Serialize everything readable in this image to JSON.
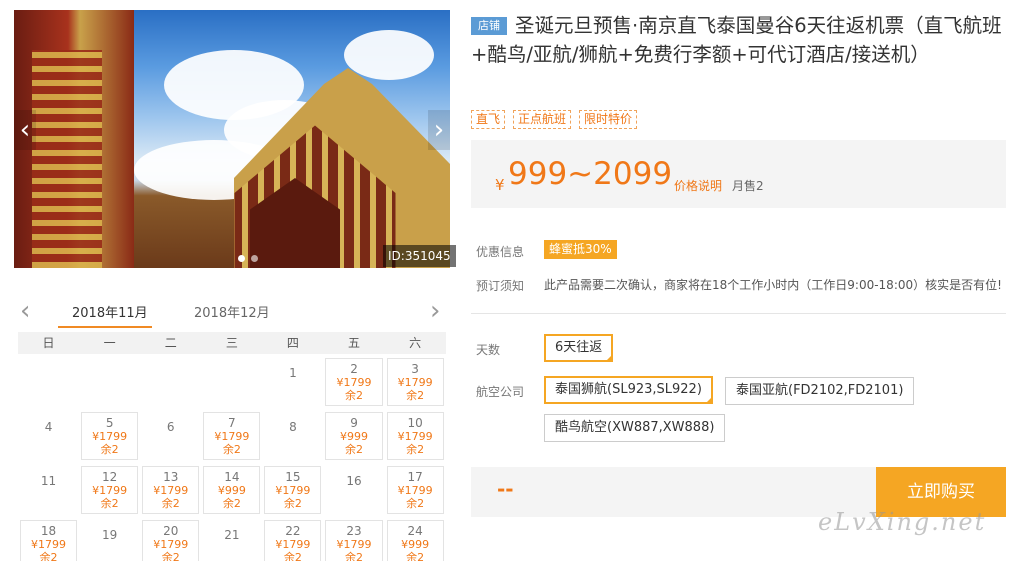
{
  "photo": {
    "id_label": "ID:351045",
    "prev_icon": "‹",
    "next_icon": "›"
  },
  "calendar": {
    "prev_icon": "‹",
    "next_icon": "›",
    "tabs": [
      {
        "label": "2018年11月",
        "active": true
      },
      {
        "label": "2018年12月",
        "active": false
      }
    ],
    "weekdays": [
      "日",
      "一",
      "二",
      "三",
      "四",
      "五",
      "六"
    ],
    "weeks": [
      [
        {
          "day": "",
          "price": "",
          "stock": ""
        },
        {
          "day": "",
          "price": "",
          "stock": ""
        },
        {
          "day": "",
          "price": "",
          "stock": ""
        },
        {
          "day": "",
          "price": "",
          "stock": ""
        },
        {
          "day": "1",
          "price": "",
          "stock": ""
        },
        {
          "day": "2",
          "price": "¥1799",
          "stock": "余2"
        },
        {
          "day": "3",
          "price": "¥1799",
          "stock": "余2"
        }
      ],
      [
        {
          "day": "4",
          "price": "",
          "stock": ""
        },
        {
          "day": "5",
          "price": "¥1799",
          "stock": "余2"
        },
        {
          "day": "6",
          "price": "",
          "stock": ""
        },
        {
          "day": "7",
          "price": "¥1799",
          "stock": "余2"
        },
        {
          "day": "8",
          "price": "",
          "stock": ""
        },
        {
          "day": "9",
          "price": "¥999",
          "stock": "余2"
        },
        {
          "day": "10",
          "price": "¥1799",
          "stock": "余2"
        }
      ],
      [
        {
          "day": "11",
          "price": "",
          "stock": ""
        },
        {
          "day": "12",
          "price": "¥1799",
          "stock": "余2"
        },
        {
          "day": "13",
          "price": "¥1799",
          "stock": "余2"
        },
        {
          "day": "14",
          "price": "¥999",
          "stock": "余2"
        },
        {
          "day": "15",
          "price": "¥1799",
          "stock": "余2"
        },
        {
          "day": "16",
          "price": "",
          "stock": ""
        },
        {
          "day": "17",
          "price": "¥1799",
          "stock": "余2"
        }
      ],
      [
        {
          "day": "18",
          "price": "¥1799",
          "stock": "余2"
        },
        {
          "day": "19",
          "price": "",
          "stock": ""
        },
        {
          "day": "20",
          "price": "¥1799",
          "stock": "余2"
        },
        {
          "day": "21",
          "price": "",
          "stock": ""
        },
        {
          "day": "22",
          "price": "¥1799",
          "stock": "余2"
        },
        {
          "day": "23",
          "price": "¥1799",
          "stock": "余2"
        },
        {
          "day": "24",
          "price": "¥999",
          "stock": "余2"
        }
      ]
    ]
  },
  "product": {
    "badge": "店铺",
    "title": "圣诞元旦预售·南京直飞泰国曼谷6天往返机票（直飞航班+酷鸟/亚航/狮航+免费行李额+可代订酒店/接送机）",
    "tags": [
      "直飞",
      "正点航班",
      "限时特价"
    ],
    "price_currency": "¥",
    "price_range": "999~2099",
    "price_note": "价格说明",
    "monthly_sales": "月售2"
  },
  "info": {
    "promo_label": "优惠信息",
    "promo_badge": "蜂蜜抵30%",
    "notice_label": "预订须知",
    "notice_text": "此产品需要二次确认，商家将在18个工作小时内（工作日9:00-18:00）核实是否有位!"
  },
  "options": {
    "days_label": "天数",
    "days": [
      {
        "label": "6天往返",
        "selected": true
      }
    ],
    "airline_label": "航空公司",
    "airlines": [
      {
        "label": "泰国狮航(SL923,SL922)",
        "selected": true
      },
      {
        "label": "泰国亚航(FD2102,FD2101)",
        "selected": false
      },
      {
        "label": "酷鸟航空(XW887,XW888)",
        "selected": false
      }
    ]
  },
  "purchase": {
    "quantity_display": "--",
    "buy_label": "立即购买"
  },
  "watermark": "eLvXing.net",
  "colors": {
    "accent": "#f5a623",
    "price": "#f07818",
    "badge": "#5b9bd5"
  }
}
